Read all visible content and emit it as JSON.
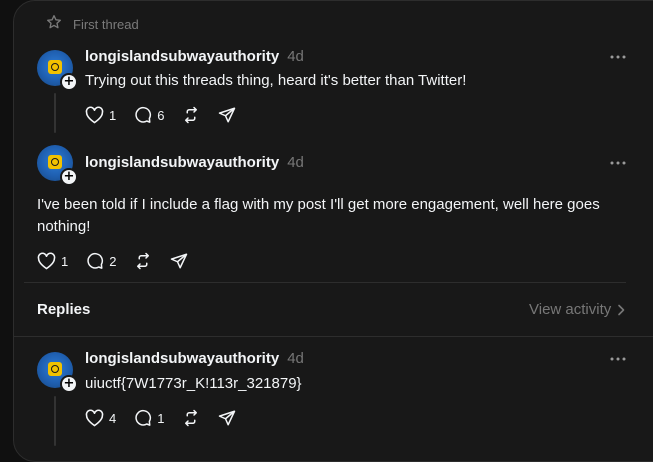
{
  "header": {
    "title": "First thread",
    "icon": "star-icon"
  },
  "posts": [
    {
      "username": "longislandsubwayauthority",
      "time": "4d",
      "text": "Trying out this threads thing, heard it's better than Twitter!",
      "likes": "1",
      "comments": "6"
    },
    {
      "username": "longislandsubwayauthority",
      "time": "4d",
      "text": "I've been told if I include a flag with my post I'll get more engagement, well here goes nothing!",
      "likes": "1",
      "comments": "2"
    }
  ],
  "replies_section": {
    "title": "Replies",
    "view_activity": "View activity"
  },
  "replies": [
    {
      "username": "longislandsubwayauthority",
      "time": "4d",
      "text": "uiuctf{7W1773r_K!113r_321879}",
      "likes": "4",
      "comments": "1"
    }
  ],
  "colors": {
    "background": "#101010",
    "panel": "#181818",
    "text": "#f3f5f7",
    "muted": "#777777",
    "avatar": "#2e7dd7"
  }
}
